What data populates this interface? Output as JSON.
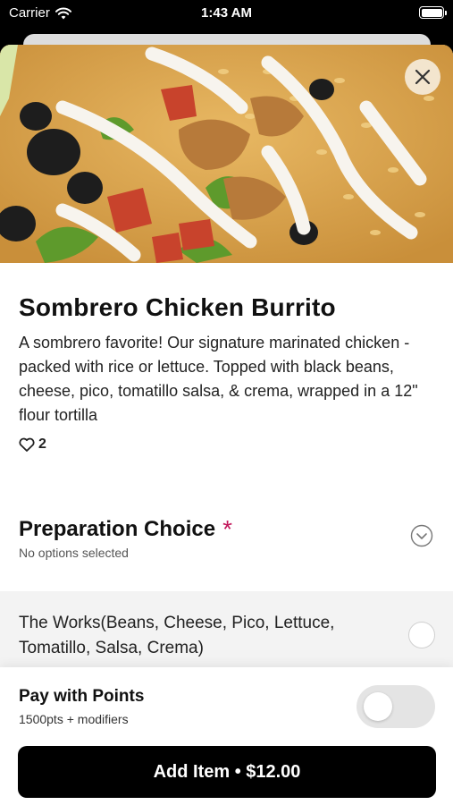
{
  "status": {
    "carrier": "Carrier",
    "time": "1:43 AM"
  },
  "item": {
    "title": "Sombrero Chicken Burrito",
    "description": "A sombrero favorite! Our signature marinated chicken - packed with rice or lettuce. Topped with black beans, cheese, pico, tomatillo salsa, & crema, wrapped in a 12\" flour tortilla",
    "likes": "2"
  },
  "preparation": {
    "title": "Preparation Choice",
    "required_mark": "*",
    "subtitle": "No options selected",
    "options": [
      {
        "label": "The Works(Beans, Cheese, Pico, Lettuce, Tomatillo, Salsa, Crema)",
        "selected": false
      }
    ]
  },
  "points": {
    "title": "Pay with Points",
    "subtitle": "1500pts + modifiers",
    "enabled": false
  },
  "cta": {
    "label": "Add Item • $12.00"
  },
  "colors": {
    "required": "#c2185b",
    "button": "#000000",
    "option_bg": "#f3f3f3"
  },
  "icons": [
    "wifi-icon",
    "battery-icon",
    "close-icon",
    "heart-icon",
    "chevron-down-icon"
  ]
}
